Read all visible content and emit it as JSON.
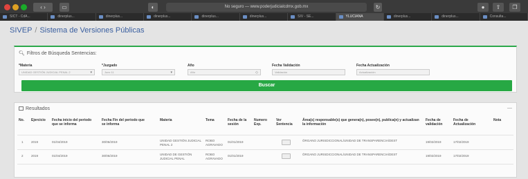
{
  "browser": {
    "url": "No seguro — www.poderjudicialcdmx.gob.mx",
    "tabs": [
      "SICT - CdA...",
      "dinerplus...",
      "dinerplus...",
      "dinerplus...",
      "dinerplus...",
      "dinerplus...",
      "SIV - SE...",
      "YLUCIANA",
      "dinerplus...",
      "dinerplus...",
      "Consulta..."
    ]
  },
  "header": {
    "app_name": "SIVEP",
    "separator": "/",
    "title": "Sistema de Versiones Públicas"
  },
  "filters": {
    "title": "Filtros de Búsqueda Sentencias:",
    "fields": [
      {
        "label": "*Materia",
        "value": "UNIDAD GESTIÓN JUDICIAL PENAL 2"
      },
      {
        "label": "*Juzgado",
        "value": "Juez 11"
      },
      {
        "label": "Año",
        "value": "Año"
      },
      {
        "label": "Fecha Validación",
        "value": "Validación"
      },
      {
        "label": "Fecha Actualización",
        "value": "Actualización"
      }
    ],
    "search_button": "Buscar"
  },
  "results": {
    "title": "Resultados",
    "collapse": "—",
    "columns": [
      "No.",
      "Ejercicio",
      "Fecha inicio del periodo que se informa",
      "Fecha Fin del periodo que se informa",
      "Materia",
      "Tema",
      "Fecha de la sesión",
      "Numero Exp.",
      "Ver Sentencia",
      "Área(s) responsable(s) que genera(n), posee(n), publica(n) y actualizan la información",
      "Fecha de validación",
      "Fecha de Actualización",
      "Nota"
    ],
    "rows": [
      {
        "no": "1",
        "ejercicio": "2019",
        "inicio": "01/04/2019",
        "fin": "30/06/2019",
        "materia": "UNIDAD GESTIÓN JUDICIAL PENAL 2",
        "tema": "ROBO AGRAVADO",
        "sesion": "01/01/2019",
        "exp": "",
        "area": "ÓRGANO JURISDICCIONAL/UNIDAD DE TRANSPARENCIA/DEST",
        "validacion": "19/02/2019",
        "actualizacion": "17/02/2019",
        "nota": ""
      },
      {
        "no": "2",
        "ejercicio": "2019",
        "inicio": "01/04/2019",
        "fin": "30/06/2019",
        "materia": "UNIDAD DE GESTIÓN JUDICIAL PENAL",
        "tema": "ROBO AGRAVADO",
        "sesion": "01/01/2019",
        "exp": "",
        "area": "ÓRGANO JURISDICCIONAL/UNIDAD DE TRANSPARENCIA/DEST",
        "validacion": "19/02/2019",
        "actualizacion": "17/02/2019",
        "nota": ""
      }
    ]
  },
  "colors": {
    "accent_green": "#27a844",
    "brand_blue": "#3a5fa0"
  }
}
